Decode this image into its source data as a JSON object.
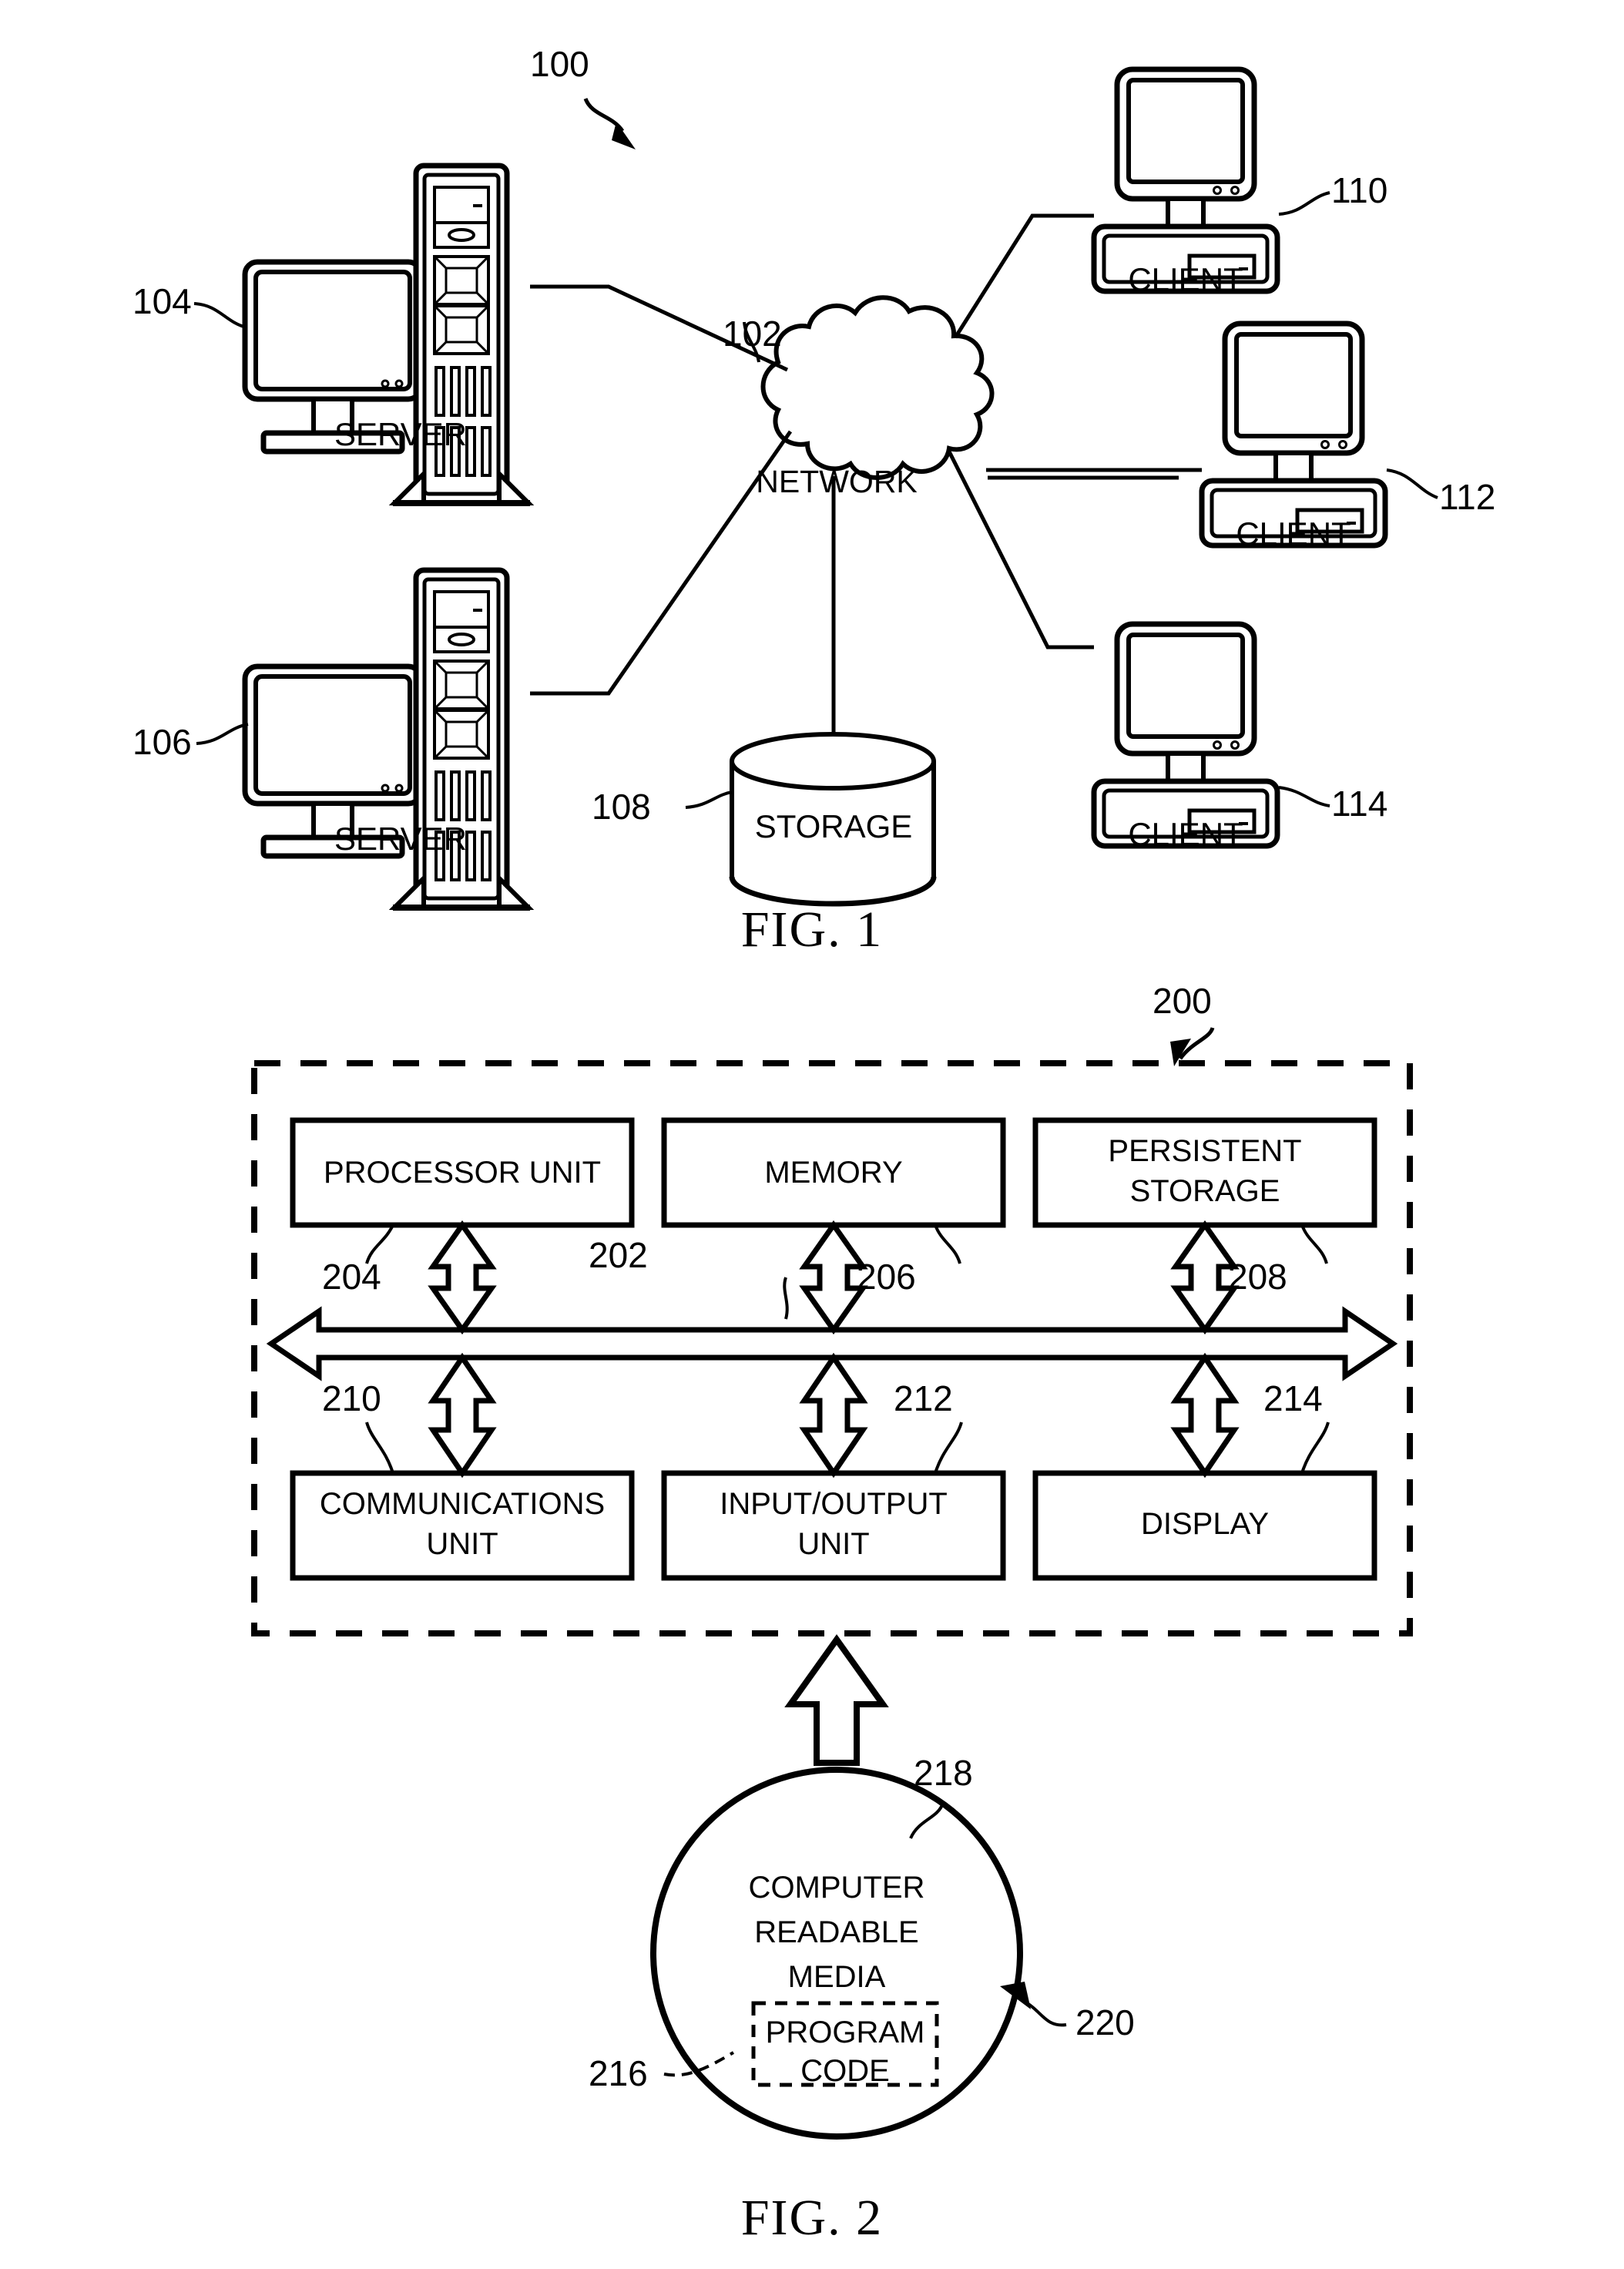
{
  "figures": [
    {
      "id": "fig1",
      "caption": "FIG. 1",
      "ref": "100",
      "nodes": {
        "network": {
          "label": "NETWORK",
          "ref": "102"
        },
        "server_top": {
          "label": "SERVER",
          "ref": "104"
        },
        "server_bottom": {
          "label": "SERVER",
          "ref": "106"
        },
        "storage": {
          "label": "STORAGE",
          "ref": "108"
        },
        "client_top": {
          "label": "CLIENT",
          "ref": "110"
        },
        "client_middle": {
          "label": "CLIENT",
          "ref": "112"
        },
        "client_bottom": {
          "label": "CLIENT",
          "ref": "114"
        }
      }
    },
    {
      "id": "fig2",
      "caption": "FIG. 2",
      "ref": "200",
      "bus_ref": "202",
      "blocks": [
        {
          "label": "PROCESSOR UNIT",
          "ref": "204"
        },
        {
          "label": "MEMORY",
          "ref": "206"
        },
        {
          "label": "PERSISTENT STORAGE",
          "ref": "208"
        },
        {
          "label": "COMMUNICATIONS UNIT",
          "ref": "210"
        },
        {
          "label": "INPUT/OUTPUT UNIT",
          "ref": "212"
        },
        {
          "label": "DISPLAY",
          "ref": "214"
        }
      ],
      "media": {
        "label": "COMPUTER READABLE MEDIA",
        "label_line1": "COMPUTER",
        "label_line2": "READABLE",
        "label_line3": "MEDIA",
        "ref": "218",
        "outer_ref": "220",
        "program": {
          "label": "PROGRAM CODE",
          "label_line1": "PROGRAM",
          "label_line2": "CODE",
          "ref": "216"
        }
      }
    }
  ],
  "labels": {
    "fig1_caption": "FIG. 1",
    "fig2_caption": "FIG. 2",
    "ref_100": "100",
    "ref_102": "102",
    "ref_104": "104",
    "ref_106": "106",
    "ref_108": "108",
    "ref_110": "110",
    "ref_112": "112",
    "ref_114": "114",
    "ref_200": "200",
    "ref_202": "202",
    "ref_204": "204",
    "ref_206": "206",
    "ref_208": "208",
    "ref_210": "210",
    "ref_212": "212",
    "ref_214": "214",
    "ref_216": "216",
    "ref_218": "218",
    "ref_220": "220",
    "network": "NETWORK",
    "server": "SERVER",
    "storage": "STORAGE",
    "client": "CLIENT",
    "processor_unit": "PROCESSOR UNIT",
    "memory": "MEMORY",
    "persistent_storage_l1": "PERSISTENT",
    "persistent_storage_l2": "STORAGE",
    "communications_unit_l1": "COMMUNICATIONS",
    "communications_unit_l2": "UNIT",
    "io_unit_l1": "INPUT/OUTPUT",
    "io_unit_l2": "UNIT",
    "display": "DISPLAY",
    "crm_l1": "COMPUTER",
    "crm_l2": "READABLE",
    "crm_l3": "MEDIA",
    "program_code_l1": "PROGRAM",
    "program_code_l2": "CODE"
  },
  "colors": {
    "ink": "#000000",
    "paper": "#ffffff"
  }
}
